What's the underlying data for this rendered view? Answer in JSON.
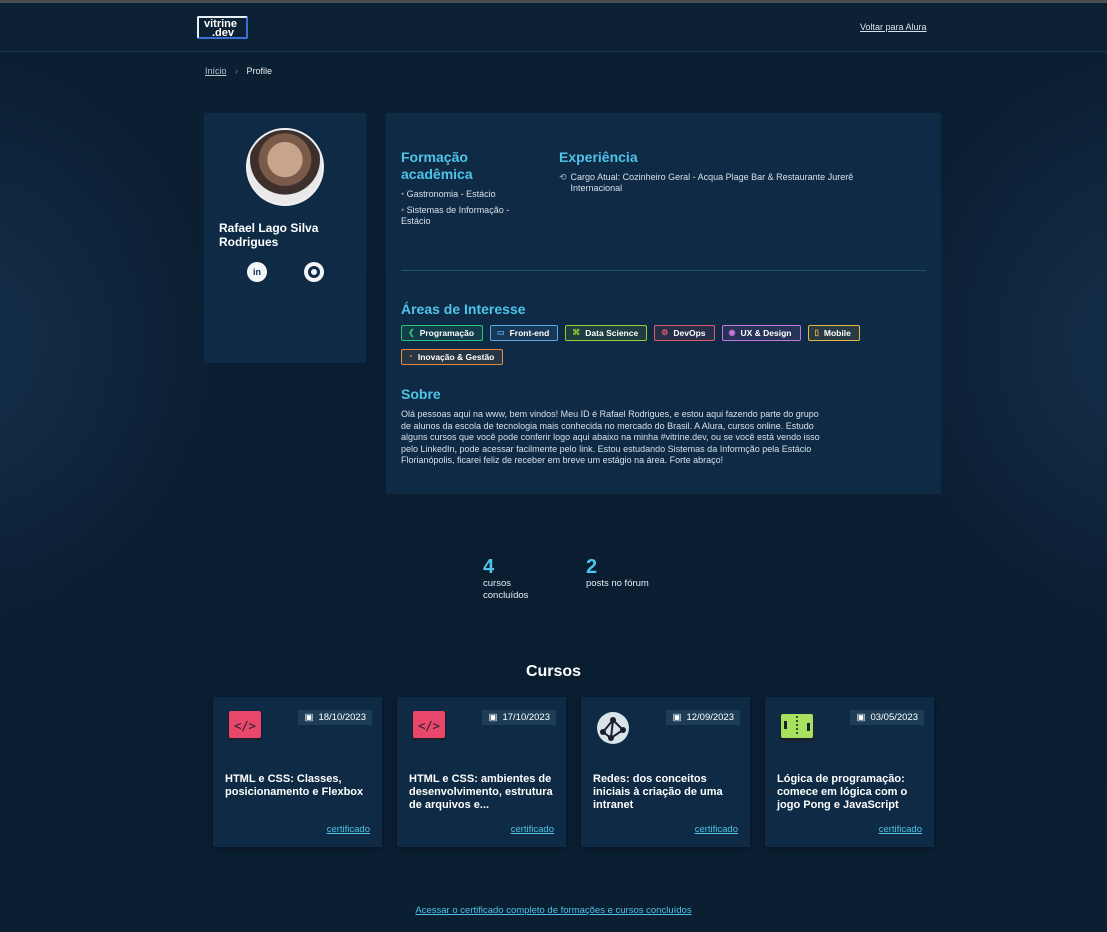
{
  "header": {
    "logo_line1": "vitrine",
    "logo_line2": ".dev",
    "back_link": "Voltar para Alura"
  },
  "breadcrumb": {
    "home": "Início",
    "current": "Profile"
  },
  "profile": {
    "name": "Rafael Lago Silva Rodrigues",
    "social": [
      {
        "icon": "linkedin-icon",
        "glyph": "in"
      },
      {
        "icon": "github-icon",
        "glyph": "gh"
      }
    ]
  },
  "education": {
    "title": "Formação acadêmica",
    "items": [
      "Gastronomia - Estácio",
      "Sistemas de Informação - Estácio"
    ]
  },
  "experience": {
    "title": "Experiência",
    "current": "Cargo Atual: Cozinheiro Geral - Acqua Plage Bar & Restaurante Jurerê Internacional"
  },
  "interests": {
    "title": "Áreas de Interesse",
    "tags": [
      {
        "label": "Programação",
        "color": "#2ec27e",
        "icon": "code-icon"
      },
      {
        "label": "Front-end",
        "color": "#5aa9e6",
        "icon": "layout-icon"
      },
      {
        "label": "Data Science",
        "color": "#9acd32",
        "icon": "chart-icon"
      },
      {
        "label": "DevOps",
        "color": "#e05d6f",
        "icon": "gear-icon"
      },
      {
        "label": "UX & Design",
        "color": "#c678dd",
        "icon": "eye-icon"
      },
      {
        "label": "Mobile",
        "color": "#e5b93e",
        "icon": "phone-icon"
      },
      {
        "label": "Inovação & Gestão",
        "color": "#e58a3e",
        "icon": "bulb-icon"
      }
    ]
  },
  "about": {
    "title": "Sobre",
    "text": "Olá pessoas aqui na www, bem vindos! Meu ID é Rafael Rodrigues, e estou aqui fazendo parte do grupo de alunos da escola de tecnologia mais conhecida no mercado do Brasil. A Alura, cursos online. Estudo alguns cursos que você pode conferir logo aqui abaixo na minha #vitrine.dev, ou se você está vendo isso pelo LinkedIn, pode acessar facilmente pelo link. Estou estudando Sistemas da Informção pela Estácio Florianópolis, ficarei feliz de receber em breve um estágio na área. Forte abraço!"
  },
  "stats": [
    {
      "value": "4",
      "label_line1": "cursos",
      "label_line2": "concluídos"
    },
    {
      "value": "2",
      "label_line1": "posts no fórum",
      "label_line2": ""
    }
  ],
  "courses": {
    "title": "Cursos",
    "items": [
      {
        "date": "18/10/2023",
        "title": "HTML e CSS: Classes, posicionamento e Flexbox",
        "link": "certificado",
        "icon": "html-css-icon"
      },
      {
        "date": "17/10/2023",
        "title": "HTML e CSS: ambientes de desenvolvimento, estrutura de arquivos e...",
        "link": "certificado",
        "icon": "html-css-icon"
      },
      {
        "date": "12/09/2023",
        "title": "Redes: dos conceitos iniciais à criação de uma intranet",
        "link": "certificado",
        "icon": "network-icon"
      },
      {
        "date": "03/05/2023",
        "title": "Lógica de programação: comece em lógica com o jogo Pong e JavaScript",
        "link": "certificado",
        "icon": "logic-icon"
      }
    ]
  },
  "footer_link": "Acessar o certificado completo de formações e cursos concluídos"
}
